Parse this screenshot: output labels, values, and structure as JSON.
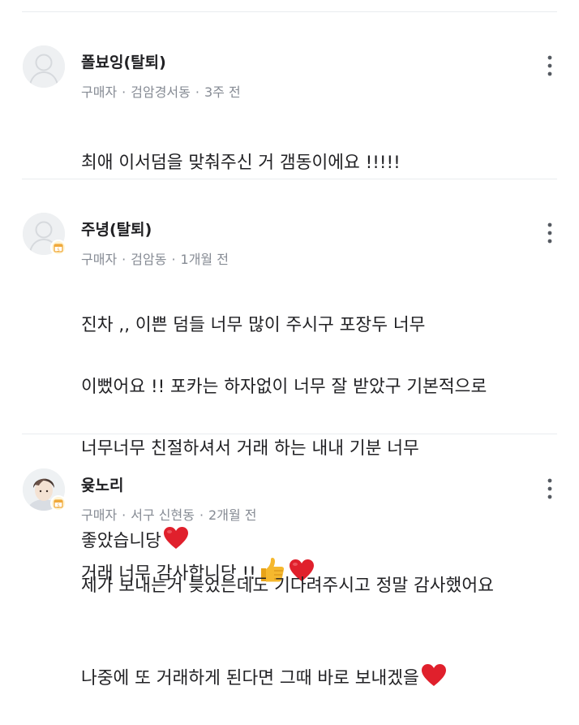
{
  "reviews": [
    {
      "name": "폴뵤잉(탈퇴)",
      "role": "구매자",
      "location": "검암경서동",
      "time": "3주 전",
      "has_badge": false,
      "avatar": "default-avatar",
      "lines": [
        "최애 이서덤을 맞춰주신 거 갬동이에요 !!!!!"
      ]
    },
    {
      "name": "주녕(탈퇴)",
      "role": "구매자",
      "location": "검암동",
      "time": "1개월 전",
      "has_badge": true,
      "avatar": "default-avatar",
      "lines": [
        "진차 ,, 이쁜 덤들 너무 많이 주시구 포장두 너무",
        "이뻤어요 !! 포카는 하자없이 너무 잘 받았구 기본적으로",
        "너무너무 친절하셔서 거래 하는 내내 기분 너무"
      ],
      "last_line_parts": [
        "좋았습니당",
        "거래 너무 감사합니당 !!"
      ]
    },
    {
      "name": "윶노리",
      "role": "구매자",
      "location": "서구 신현동",
      "time": "2개월 전",
      "has_badge": true,
      "avatar": "photo-avatar",
      "lines": [
        "제가 보내는거 늦었는데도 기다려주시고 정말 감사했어요",
        "나중에 또 거래하게 된다면 그때 바로 보내겠을"
      ]
    }
  ],
  "icons": {
    "more": "more-vertical-icon",
    "heart": "red-heart-emoji",
    "thumbs": "thumbs-up-emoji",
    "badge": "calendar-badge-icon"
  },
  "colors": {
    "name": "#212124",
    "meta": "#868b94",
    "divider": "#e9ecef",
    "heart": "#e0202c",
    "thumbs": "#f5b82e"
  }
}
